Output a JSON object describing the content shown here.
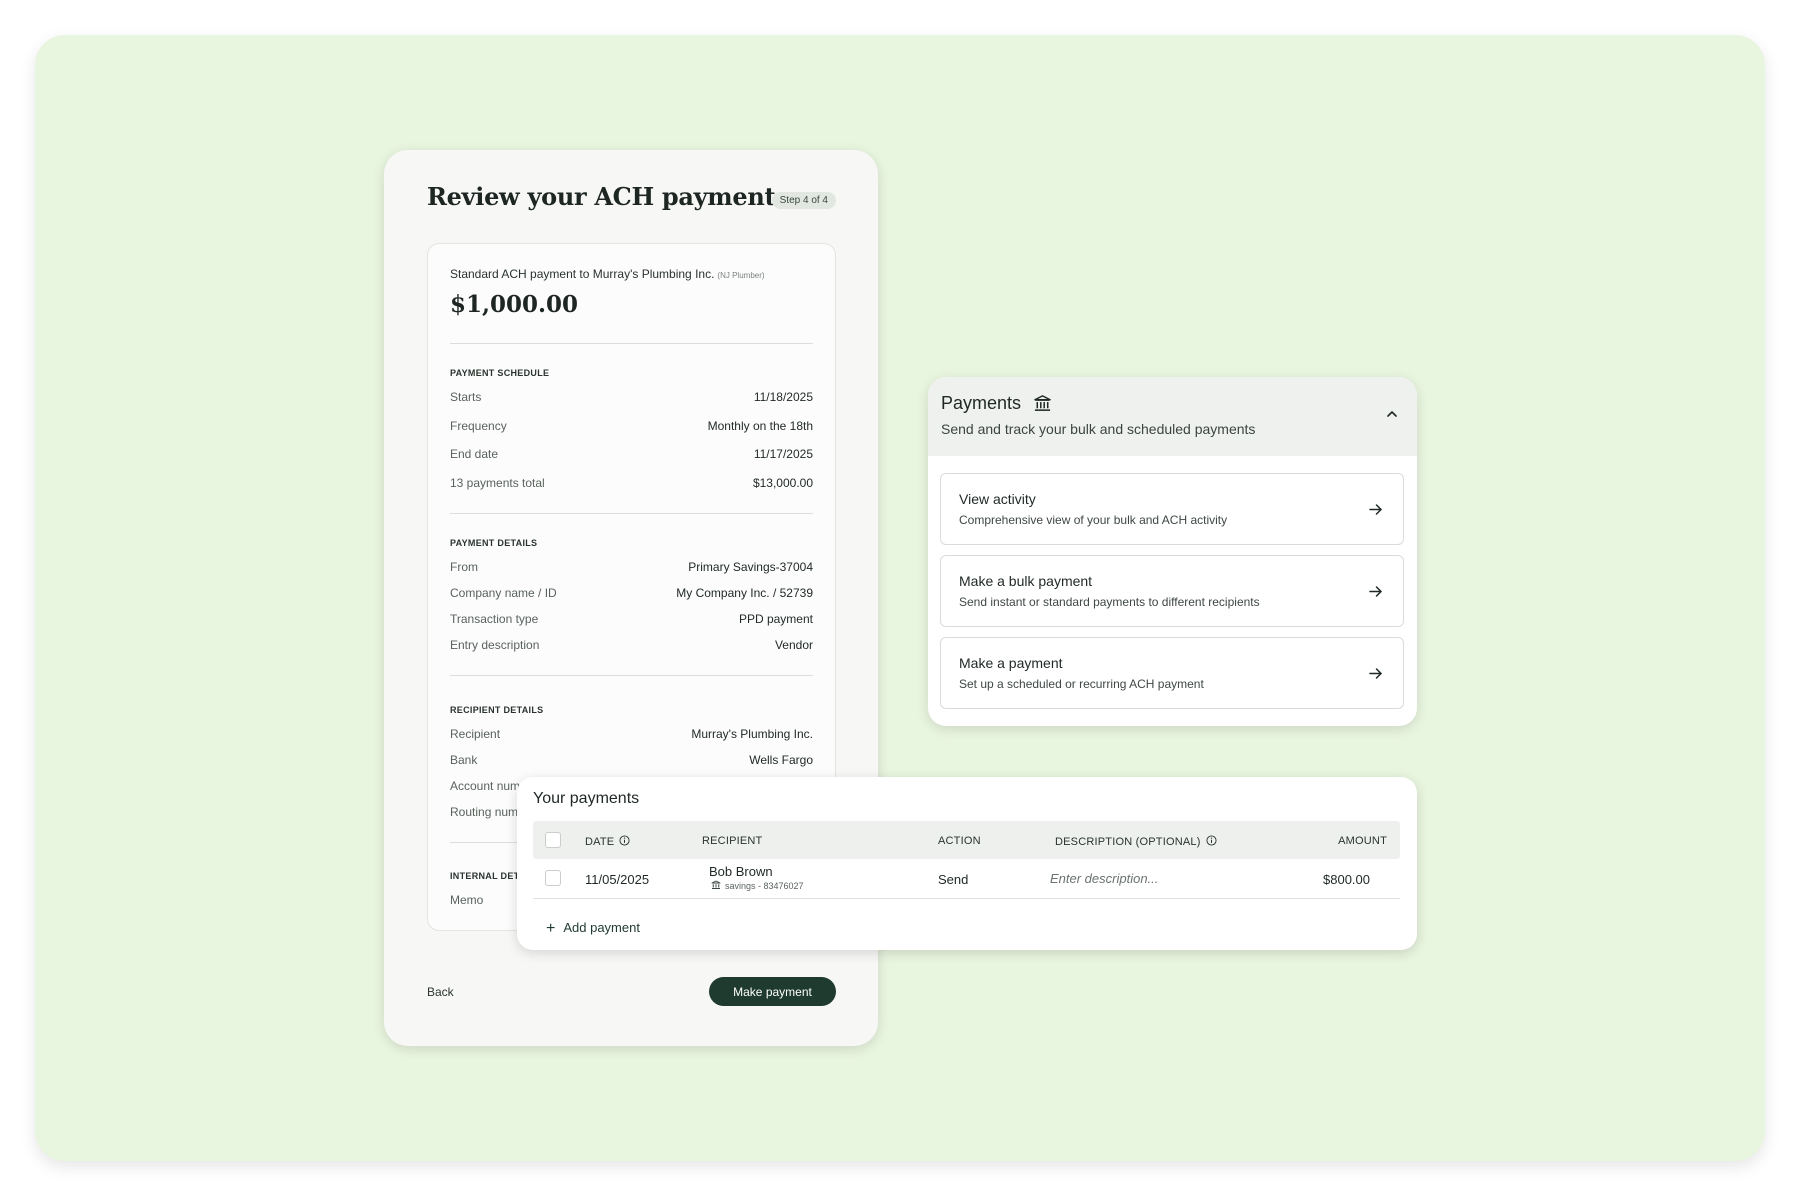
{
  "review": {
    "title": "Review your ACH payment",
    "step_badge": "Step 4 of 4",
    "payment_line": "Standard ACH payment to Murray's Plumbing Inc.",
    "payment_tag": "(NJ Plumber)",
    "amount": "$1,000.00",
    "schedule": {
      "label": "PAYMENT SCHEDULE",
      "rows": [
        {
          "label": "Starts",
          "value": "11/18/2025"
        },
        {
          "label": "Frequency",
          "value": "Monthly on the 18th"
        },
        {
          "label": "End date",
          "value": "11/17/2025"
        },
        {
          "label": "13 payments total",
          "value": "$13,000.00"
        }
      ]
    },
    "details": {
      "label": "PAYMENT DETAILS",
      "rows": [
        {
          "label": "From",
          "value": "Primary Savings-37004"
        },
        {
          "label": "Company name / ID",
          "value": "My Company Inc. / 52739"
        },
        {
          "label": "Transaction type",
          "value": "PPD payment"
        },
        {
          "label": "Entry description",
          "value": "Vendor"
        }
      ]
    },
    "recipient": {
      "label": "RECIPIENT DETAILS",
      "rows": [
        {
          "label": "Recipient",
          "value": "Murray's Plumbing Inc."
        },
        {
          "label": "Bank",
          "value": "Wells Fargo"
        },
        {
          "label": "Account num",
          "value": ""
        },
        {
          "label": "Routing num",
          "value": ""
        }
      ]
    },
    "internal": {
      "label": "INTERNAL DETA",
      "rows": [
        {
          "label": "Memo",
          "value": ""
        }
      ]
    },
    "back_label": "Back",
    "submit_label": "Make payment"
  },
  "payments": {
    "title": "Payments",
    "subtitle": "Send and track your bulk and scheduled payments",
    "actions": [
      {
        "title": "View activity",
        "subtitle": "Comprehensive view of your bulk and ACH activity"
      },
      {
        "title": "Make a bulk payment",
        "subtitle": "Send instant or standard payments to different recipients"
      },
      {
        "title": "Make a payment",
        "subtitle": "Set up a scheduled or recurring ACH payment"
      }
    ]
  },
  "your_payments": {
    "title": "Your payments",
    "columns": {
      "date": "DATE",
      "recipient": "RECIPIENT",
      "action": "ACTION",
      "description": "DESCRIPTION (OPTIONAL)",
      "amount": "AMOUNT"
    },
    "rows": [
      {
        "date": "11/05/2025",
        "recipient_name": "Bob Brown",
        "recipient_account": "savings - 83476027",
        "action": "Send",
        "description_placeholder": "Enter description...",
        "amount": "$800.00"
      }
    ],
    "add_label": "Add payment"
  },
  "colors": {
    "background": "#e8f5df",
    "primary_button": "#1f3a2e",
    "panel_header": "#eef1ee"
  }
}
